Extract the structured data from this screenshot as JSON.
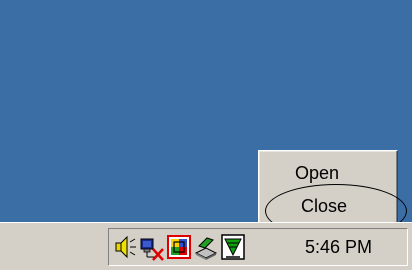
{
  "context_menu": {
    "items": [
      {
        "label": "Open"
      },
      {
        "label": "Close"
      }
    ]
  },
  "taskbar": {
    "tray_icons": [
      "speaker-icon",
      "network-disconnected-icon",
      "keyboard-layout-icon",
      "safely-remove-hardware-icon",
      "download-funnel-icon"
    ],
    "clock": "5:46 PM"
  },
  "colors": {
    "desktop": "#3a6ea5",
    "taskbar": "#d4d0c8",
    "annotation_ellipse": "#000000"
  }
}
